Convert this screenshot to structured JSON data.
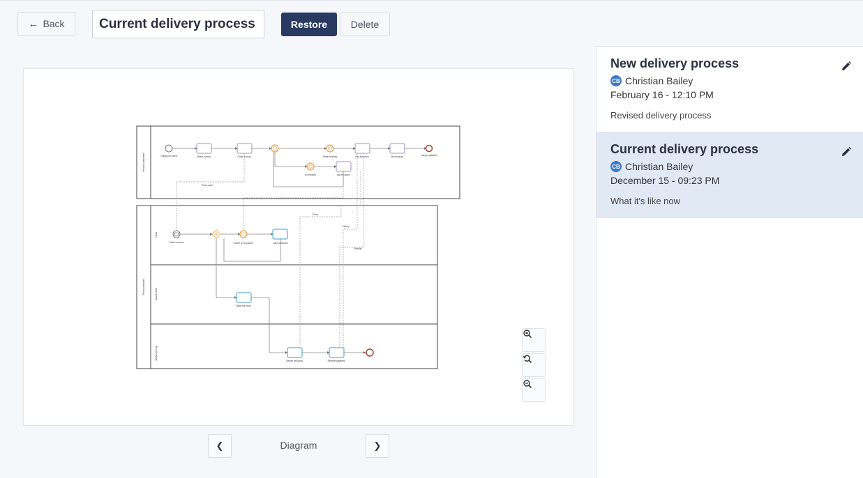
{
  "toolbar": {
    "back_label": "Back",
    "title_value": "Current delivery process",
    "restore_label": "Restore",
    "delete_label": "Delete"
  },
  "diagram": {
    "pager_label": "Diagram",
    "pools": [
      {
        "label": "Pizza customer",
        "lanes": [],
        "nodes": [
          "Hungry for pizza",
          "Select a pizza",
          "Order a pizza",
          "Pizza received",
          "Pay the pizza",
          "Eat the pizza",
          "Hunger satisfied",
          "60 minutes",
          "Ask for pizza"
        ]
      },
      {
        "label": "Pizza vendor",
        "lanes": [
          "clerk",
          "pizza chef",
          "delivery boy"
        ],
        "nodes": [
          "Order received",
          "\"where is my pizza?\"",
          "Calm customer",
          "Bake the pizza",
          "Deliver the pizza",
          "Receive payment"
        ]
      }
    ],
    "messages": [
      "Pizza order",
      "Pizza",
      "Money",
      "Receipt"
    ]
  },
  "icons": {
    "back": "arrow-left-icon",
    "zoom_in": "zoom-in-icon",
    "zoom_reset": "zoom-reset-icon",
    "zoom_out": "zoom-out-icon",
    "prev": "chevron-left-icon",
    "next": "chevron-right-icon",
    "edit": "pencil-icon"
  },
  "versions": [
    {
      "title": "New delivery process",
      "author_initials": "CB",
      "author": "Christian Bailey",
      "date": "February 16 - 12:10 PM",
      "description": "Revised delivery process",
      "active": false
    },
    {
      "title": "Current delivery process",
      "author_initials": "CB",
      "author": "Christian Bailey",
      "date": "December 15 - 09:23 PM",
      "description": "What it's like now",
      "active": true
    }
  ],
  "colors": {
    "primary": "#283a62",
    "active_card": "#e1e9f5",
    "avatar": "#3d7ac6",
    "task_user": "#8a6fb0",
    "task_vendor": "#3a9ad9",
    "event_orange": "#e8a04c",
    "end_event": "#b0402a"
  }
}
